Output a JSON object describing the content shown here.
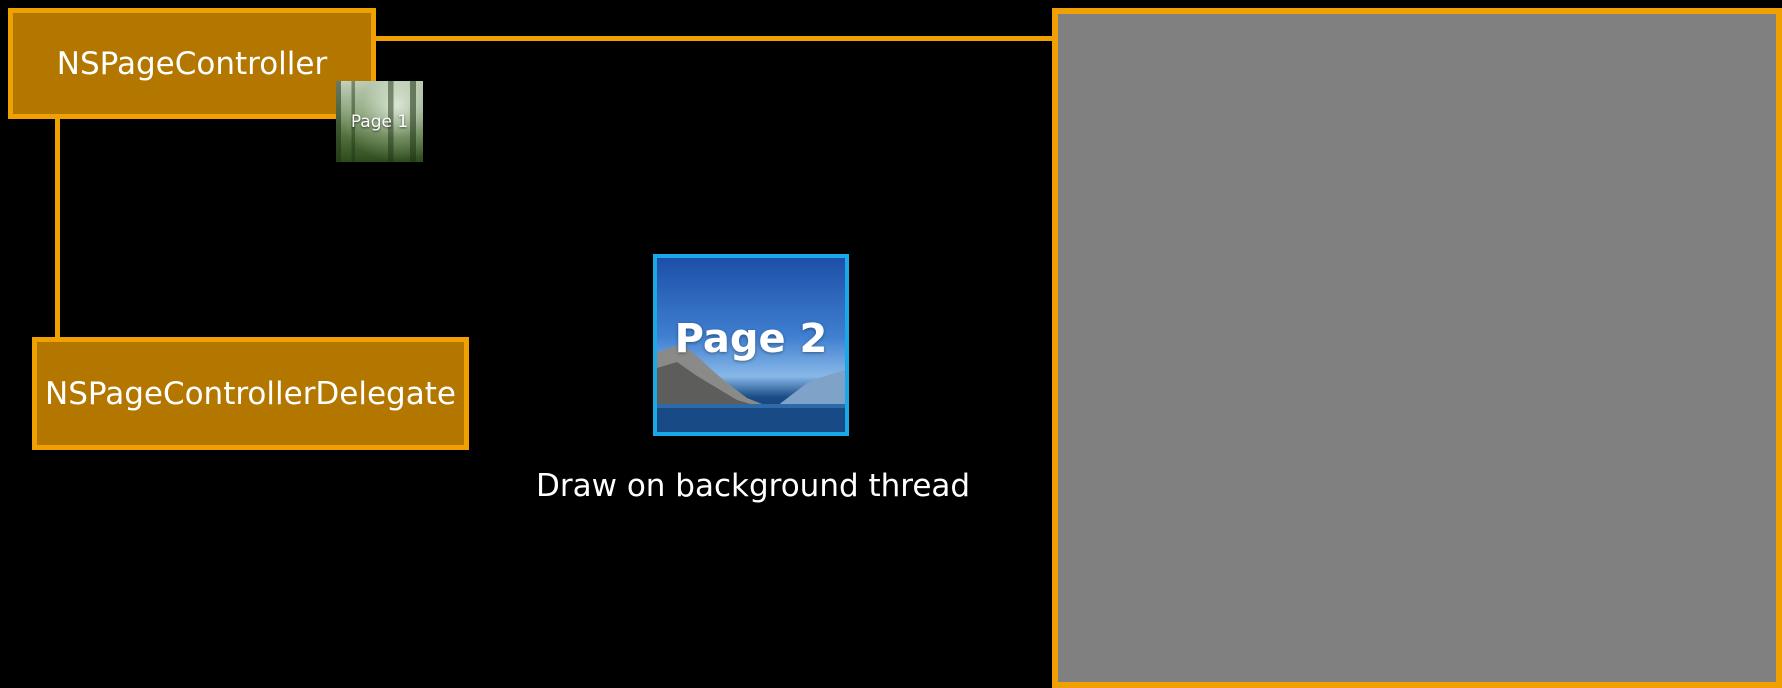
{
  "diagram": {
    "controller_label": "NSPageController",
    "delegate_label": "NSPageControllerDelegate",
    "page1_label": "Page 1",
    "page2_label": "Page 2",
    "caption": "Draw on background thread"
  },
  "colors": {
    "box_fill": "#b37700",
    "box_border": "#f0a000",
    "panel_fill": "#808080",
    "page2_border": "#1aa8e8",
    "background": "#000000"
  }
}
